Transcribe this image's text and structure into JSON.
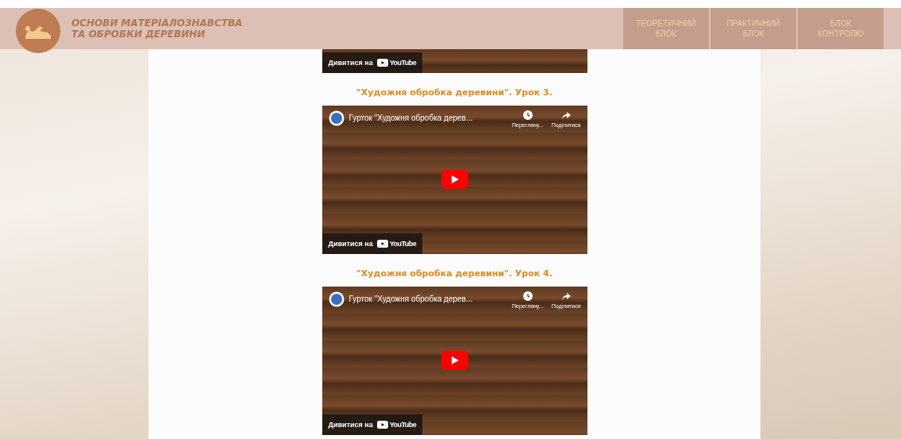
{
  "header": {
    "title_lines": [
      "ОСНОВИ МАТЕРІАЛОЗНАВСТВА",
      "ТА ОБРОБКИ ДЕРЕВИНИ"
    ]
  },
  "nav": [
    {
      "lines": [
        "ТЕОРЕТИЧНИЙ",
        "БЛОК"
      ]
    },
    {
      "lines": [
        "ПРАКТИЧНИЙ",
        "БЛОК"
      ]
    },
    {
      "lines": [
        "БЛОК",
        "КОНТРОЛЮ"
      ]
    }
  ],
  "videos": [
    {
      "kind": "partial",
      "watch_on": "Дивитися на",
      "brand": "YouTube"
    },
    {
      "kind": "full",
      "title": "\"Художня обробка деревини\". Урок 3.",
      "channel": "Гурток \"Художня обробка дерев...",
      "watch_later": "Переглянy...",
      "share": "Поділитися",
      "watch_on": "Дивитися на",
      "brand": "YouTube"
    },
    {
      "kind": "full",
      "title": "\"Художня обробка деревини\". Урок 4.",
      "channel": "Гурток \"Художня обробка дерев...",
      "watch_later": "Переглянy...",
      "share": "Поділитися",
      "watch_on": "Дивитися на",
      "brand": "YouTube"
    }
  ]
}
